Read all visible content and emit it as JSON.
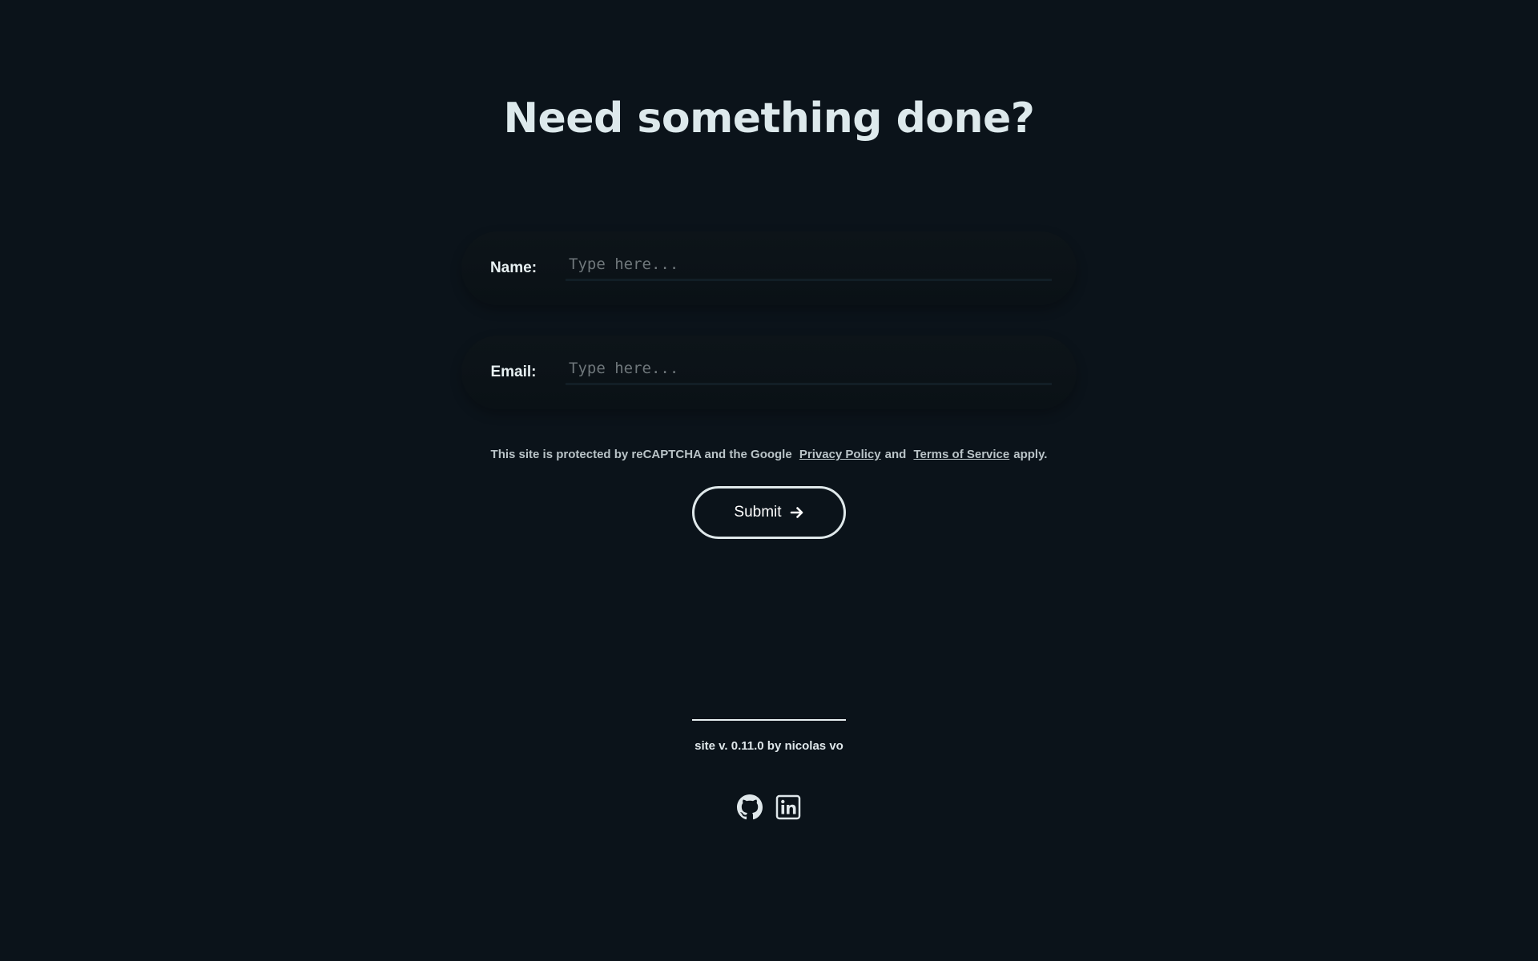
{
  "header": {
    "title": "Need something done?"
  },
  "form": {
    "name_label": "Name:",
    "name_placeholder": "Type here...",
    "email_label": "Email:",
    "email_placeholder": "Type here...",
    "recaptcha_text": "This site is protected by reCAPTCHA and the Google",
    "privacy_link": "Privacy Policy",
    "and_text": "and",
    "terms_link": "Terms of Service",
    "apply_text": "apply.",
    "submit_label": "Submit",
    "submit_icon": "arrow-right-icon"
  },
  "footer": {
    "version_text": "site v. 0.11.0 by nicolas vo",
    "social_icons": [
      "github-icon",
      "linkedin-icon"
    ]
  },
  "colors": {
    "background": "#0b131a",
    "text": "#dde9ec",
    "field_bg": "#0d1419",
    "placeholder": "#6f777b"
  }
}
